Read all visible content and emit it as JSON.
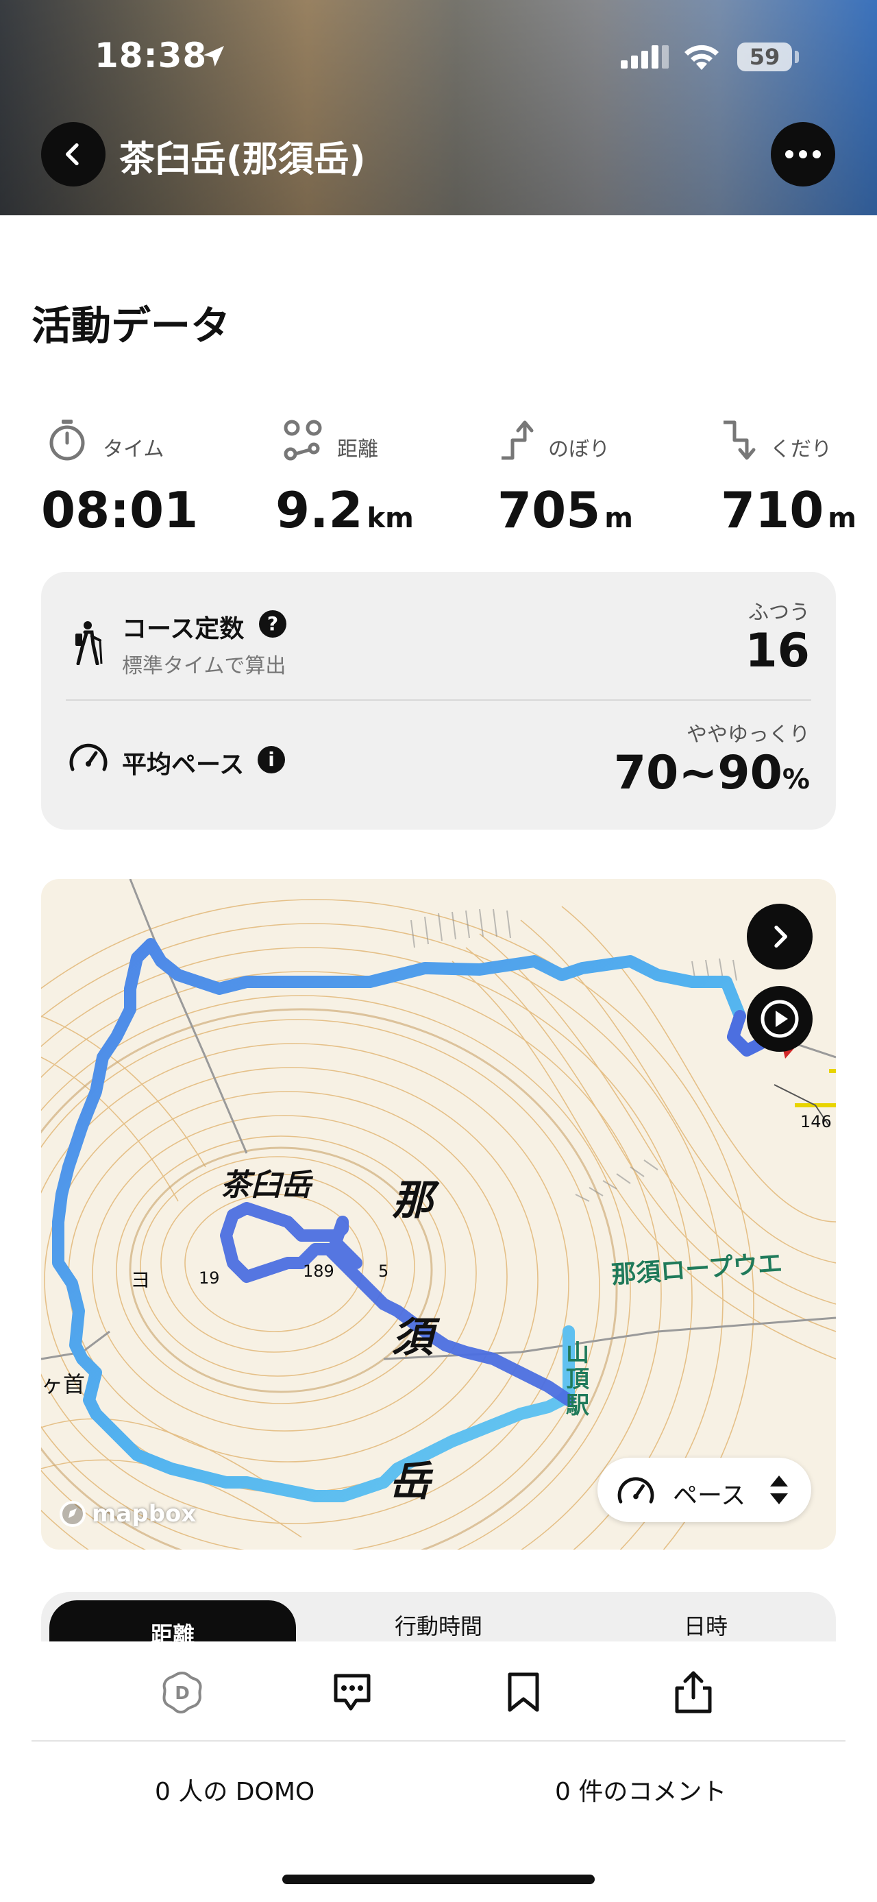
{
  "status_bar": {
    "time": "18:38",
    "battery": "59"
  },
  "header": {
    "title": "茶臼岳(那須岳)"
  },
  "section_title": "活動データ",
  "stats": [
    {
      "label": "タイム",
      "value": "08:01",
      "unit": "",
      "icon": "stopwatch-icon"
    },
    {
      "label": "距離",
      "value": "9.2",
      "unit": "km",
      "icon": "route-icon"
    },
    {
      "label": "のぼり",
      "value": "705",
      "unit": "m",
      "icon": "ascent-icon"
    },
    {
      "label": "くだり",
      "value": "710",
      "unit": "m",
      "icon": "descent-icon"
    }
  ],
  "course_constant": {
    "title": "コース定数",
    "subtitle": "標準タイムで算出",
    "rating": "ふつう",
    "value": "16"
  },
  "average_pace": {
    "title": "平均ペース",
    "rating": "ややゆっくり",
    "value": "70~90",
    "unit": "%"
  },
  "map": {
    "labels": {
      "peak": "茶臼岳",
      "kanji_1": "那",
      "kanji_2": "須",
      "kanji_3": "岳",
      "ropeway": "那須ロープウエ",
      "station_1": "山",
      "station_2": "頂",
      "station_3": "駅",
      "elev_a": "19",
      "elev_b": "189",
      "elev_c": "5",
      "elev_d": "146",
      "left_edge": "ヶ首",
      "edge_char": "ヨ"
    },
    "attribution": "mapbox",
    "mode_label": "ペース",
    "route_colors": {
      "start": "#4a6fe0",
      "mid": "#4aa8ee",
      "end": "#5fd0f0"
    }
  },
  "tabs": [
    "距離",
    "行動時間",
    "日時"
  ],
  "active_tab": "距離",
  "bottom": {
    "domo": "0 人の DOMO",
    "comments": "0 件のコメント"
  }
}
